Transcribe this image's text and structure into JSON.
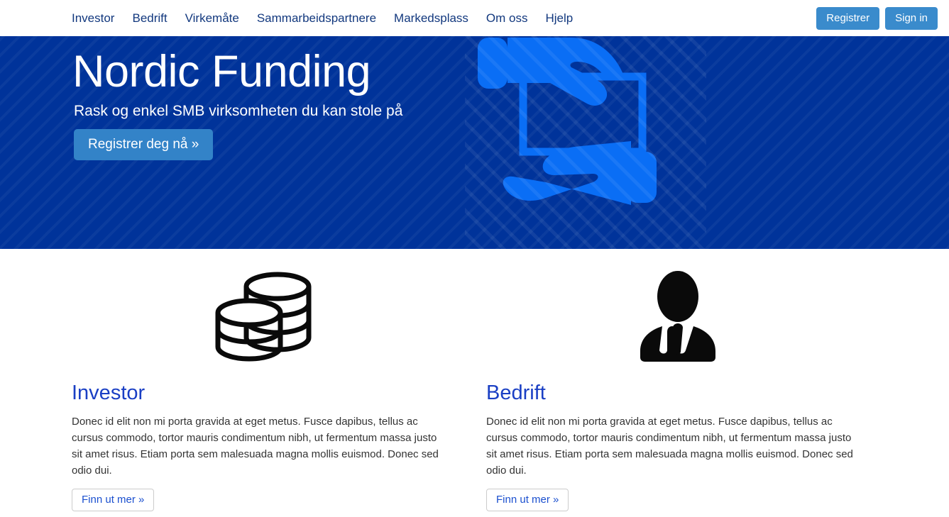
{
  "navbar": {
    "links": [
      {
        "label": "Investor",
        "name": "nav-link-investor"
      },
      {
        "label": "Bedrift",
        "name": "nav-link-bedrift"
      },
      {
        "label": "Virkemåte",
        "name": "nav-link-virkemate"
      },
      {
        "label": "Sammarbeidspartnere",
        "name": "nav-link-sammarbeidspartnere"
      },
      {
        "label": "Markedsplass",
        "name": "nav-link-markedsplass"
      },
      {
        "label": "Om oss",
        "name": "nav-link-om-oss"
      },
      {
        "label": "Hjelp",
        "name": "nav-link-hjelp"
      }
    ],
    "register_label": "Registrer",
    "signin_label": "Sign in",
    "link_color": "#12387e",
    "button_color": "#3a8bcc"
  },
  "hero": {
    "title": "Nordic Funding",
    "subtitle": "Rask og enkel SMB virksomheten du kan stole på",
    "cta_label": "Registrer deg nå »",
    "background_color": "#00339a",
    "cta_color": "#3383c8",
    "illustration": "handshake-exchange-card-icon"
  },
  "features": [
    {
      "icon": "coin-stacks-icon",
      "title": "Investor",
      "text": "Donec id elit non mi porta gravida at eget metus. Fusce dapibus, tellus ac cursus commodo, tortor mauris condimentum nibh, ut fermentum massa justo sit amet risus. Etiam porta sem malesuada magna mollis euismod. Donec sed odio dui.",
      "button_label": "Finn ut mer »",
      "title_color": "#1a3fc4"
    },
    {
      "icon": "businessperson-icon",
      "title": "Bedrift",
      "text": "Donec id elit non mi porta gravida at eget metus. Fusce dapibus, tellus ac cursus commodo, tortor mauris condimentum nibh, ut fermentum massa justo sit amet risus. Etiam porta sem malesuada magna mollis euismod. Donec sed odio dui.",
      "button_label": "Finn ut mer »",
      "title_color": "#1a3fc4"
    }
  ]
}
